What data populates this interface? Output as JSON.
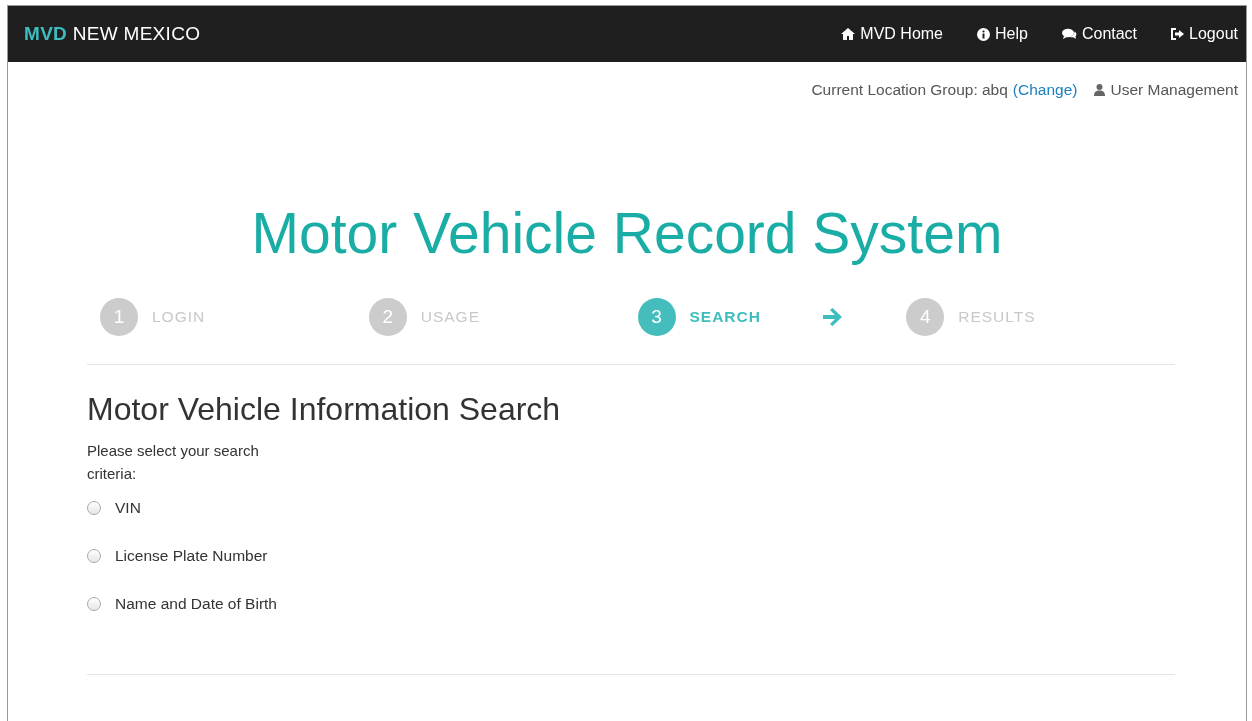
{
  "navbar": {
    "brand_bold": "MVD",
    "brand_rest": "NEW MEXICO",
    "links": [
      {
        "label": "MVD Home",
        "kind": "home"
      },
      {
        "label": "Help",
        "kind": "help"
      },
      {
        "label": "Contact",
        "kind": "contact"
      },
      {
        "label": "Logout",
        "kind": "logout"
      }
    ]
  },
  "location_bar": {
    "label": "Current Location Group: abq",
    "change_link": "(Change)",
    "user_management": "User Management"
  },
  "title": "Motor Vehicle Record System",
  "steps": [
    {
      "number": "1",
      "label": "LOGIN",
      "selected": false
    },
    {
      "number": "2",
      "label": "USAGE",
      "selected": false
    },
    {
      "number": "3",
      "label": "SEARCH",
      "selected": true
    },
    {
      "number": "4",
      "label": "RESULTS",
      "selected": false
    }
  ],
  "search": {
    "heading": "Motor Vehicle Information Search",
    "prompt": "Please select your search criteria:",
    "options": [
      {
        "label": "VIN",
        "selected": false
      },
      {
        "label": "License Plate Number",
        "selected": false
      },
      {
        "label": "Name and Date of Birth",
        "selected": false
      }
    ]
  }
}
